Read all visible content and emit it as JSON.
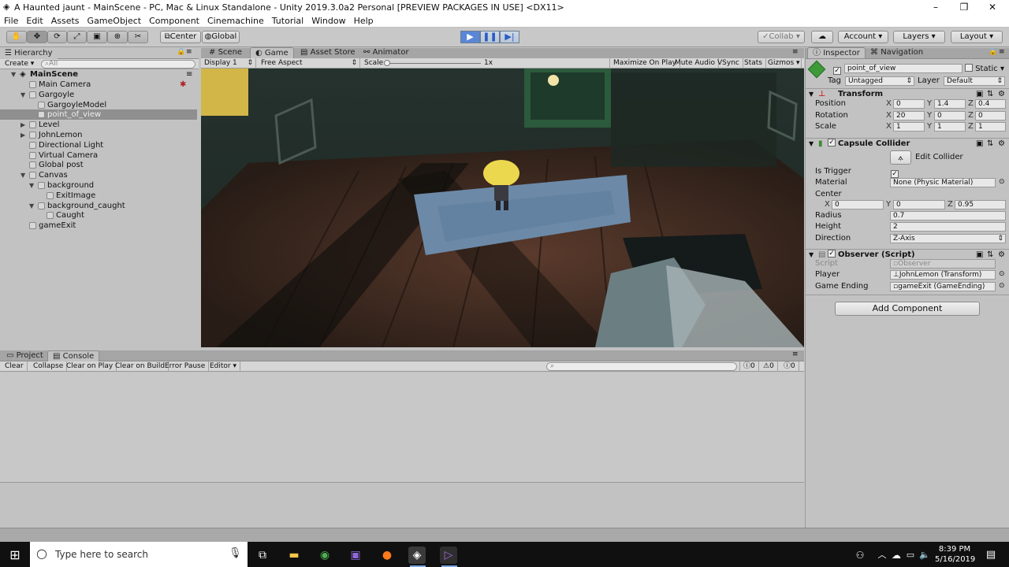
{
  "window": {
    "title": "A Haunted jaunt - MainScene - PC, Mac & Linux Standalone - Unity 2019.3.0a2 Personal [PREVIEW PACKAGES IN USE] <DX11>",
    "controls": [
      "–",
      "❐",
      "✕"
    ]
  },
  "menu": [
    "File",
    "Edit",
    "Assets",
    "GameObject",
    "Component",
    "Cinemachine",
    "Tutorial",
    "Window",
    "Help"
  ],
  "toolbar": {
    "pivot": "Center",
    "space": "Global",
    "collab": "Collab",
    "account": "Account",
    "layers": "Layers",
    "layout": "Layout"
  },
  "hierarchy": {
    "tab": "Hierarchy",
    "create": "Create",
    "search_placeholder": "All",
    "scene": "MainScene",
    "items": [
      {
        "label": "Main Camera",
        "depth": 1,
        "arrow": "",
        "selected": false
      },
      {
        "label": "Gargoyle",
        "depth": 1,
        "arrow": "▼",
        "selected": false
      },
      {
        "label": "GargoyleModel",
        "depth": 2,
        "arrow": "",
        "selected": false
      },
      {
        "label": "point_of_view",
        "depth": 2,
        "arrow": "",
        "selected": true
      },
      {
        "label": "Level",
        "depth": 1,
        "arrow": "▶",
        "selected": false
      },
      {
        "label": "JohnLemon",
        "depth": 1,
        "arrow": "▶",
        "selected": false
      },
      {
        "label": "Directional Light",
        "depth": 1,
        "arrow": "",
        "selected": false
      },
      {
        "label": "Virtual Camera",
        "depth": 1,
        "arrow": "",
        "selected": false
      },
      {
        "label": "Global post",
        "depth": 1,
        "arrow": "",
        "selected": false
      },
      {
        "label": "Canvas",
        "depth": 1,
        "arrow": "▼",
        "selected": false
      },
      {
        "label": "background",
        "depth": 2,
        "arrow": "▼",
        "selected": false
      },
      {
        "label": "ExitImage",
        "depth": 3,
        "arrow": "",
        "selected": false
      },
      {
        "label": "background_caught",
        "depth": 2,
        "arrow": "▼",
        "selected": false
      },
      {
        "label": "Caught",
        "depth": 3,
        "arrow": "",
        "selected": false
      },
      {
        "label": "gameExit",
        "depth": 1,
        "arrow": "",
        "selected": false
      }
    ]
  },
  "center_tabs": [
    "Scene",
    "Game",
    "Asset Store",
    "Animator"
  ],
  "game_bar": {
    "display": "Display 1",
    "aspect": "Free Aspect",
    "scale_label": "Scale",
    "scale_value": "1x",
    "maximize": "Maximize On Play",
    "mute": "Mute Audio",
    "vsync": "VSync",
    "stats": "Stats",
    "gizmos": "Gizmos"
  },
  "console": {
    "tabs": [
      "Project",
      "Console"
    ],
    "buttons": [
      "Clear",
      "Collapse",
      "Clear on Play",
      "Clear on Build",
      "Error Pause",
      "Editor"
    ],
    "counts": [
      "0",
      "0",
      "0"
    ]
  },
  "inspector": {
    "tabs": [
      "Inspector",
      "Navigation"
    ],
    "object_name": "point_of_view",
    "static_label": "Static",
    "tag_label": "Tag",
    "tag_value": "Untagged",
    "layer_label": "Layer",
    "layer_value": "Default",
    "transform": {
      "title": "Transform",
      "rows": [
        {
          "label": "Position",
          "x": "0",
          "y": "1.4",
          "z": "0.4"
        },
        {
          "label": "Rotation",
          "x": "20",
          "y": "0",
          "z": "0"
        },
        {
          "label": "Scale",
          "x": "1",
          "y": "1",
          "z": "1"
        }
      ]
    },
    "capsule": {
      "title": "Capsule Collider",
      "edit_collider": "Edit Collider",
      "is_trigger_label": "Is Trigger",
      "material_label": "Material",
      "material_value": "None (Physic Material)",
      "center_label": "Center",
      "center_x": "0",
      "center_y": "0",
      "center_z": "0.95",
      "radius_label": "Radius",
      "radius_value": "0.7",
      "height_label": "Height",
      "height_value": "2",
      "direction_label": "Direction",
      "direction_value": "Z-Axis"
    },
    "observer": {
      "title": "Observer (Script)",
      "script_label": "Script",
      "script_value": "Observer",
      "player_label": "Player",
      "player_value": "JohnLemon (Transform)",
      "ending_label": "Game Ending",
      "ending_value": "gameExit (GameEnding)"
    },
    "add_component": "Add Component"
  },
  "taskbar": {
    "search_placeholder": "Type here to search",
    "time": "8:39 PM",
    "date": "5/16/2019"
  }
}
